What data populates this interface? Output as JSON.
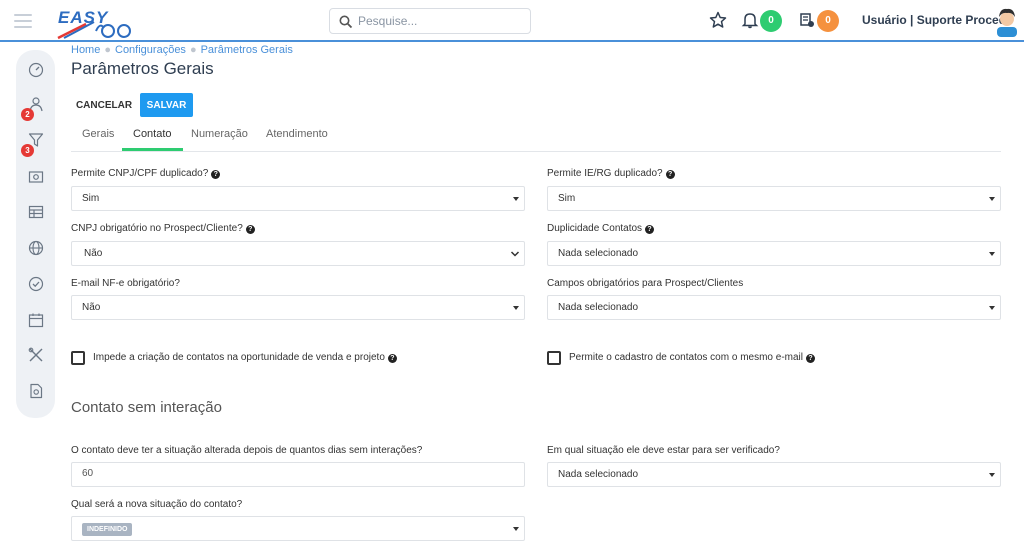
{
  "header": {
    "logo_text": "EASY",
    "search_placeholder": "Pesquise...",
    "notifications_count": "0",
    "tasks_count": "0",
    "user_label": "Usuário | Suporte Procedo",
    "colors": {
      "accent": "#4a90d9",
      "green_badge": "#2ecc71",
      "orange_badge": "#f5913e"
    }
  },
  "sidebar": {
    "items": [
      {
        "icon": "dashboard-icon"
      },
      {
        "icon": "user-icon",
        "badge": "2"
      },
      {
        "icon": "funnel-icon",
        "badge": "3"
      },
      {
        "icon": "money-icon"
      },
      {
        "icon": "table-icon"
      },
      {
        "icon": "globe-icon"
      },
      {
        "icon": "check-circle-icon"
      },
      {
        "icon": "calendar-icon"
      },
      {
        "icon": "tools-icon"
      },
      {
        "icon": "document-icon"
      }
    ]
  },
  "breadcrumb": {
    "home": "Home",
    "config": "Configurações",
    "current": "Parâmetros Gerais"
  },
  "page": {
    "title": "Parâmetros Gerais"
  },
  "toolbar": {
    "cancel_label": "CANCELAR",
    "save_label": "SALVAR"
  },
  "tabs": [
    {
      "label": "Gerais",
      "active": false
    },
    {
      "label": "Contato",
      "active": true
    },
    {
      "label": "Numeração",
      "active": false
    },
    {
      "label": "Atendimento",
      "active": false
    }
  ],
  "form": {
    "cnpj_dup": {
      "label": "Permite CNPJ/CPF duplicado?",
      "value": "Sim"
    },
    "ie_dup": {
      "label": "Permite IE/RG duplicado?",
      "value": "Sim"
    },
    "cnpj_obrig": {
      "label": "CNPJ obrigatório no Prospect/Cliente?",
      "value": "Não"
    },
    "dup_contatos": {
      "label": "Duplicidade Contatos",
      "value": "Nada selecionado"
    },
    "email_nfe": {
      "label": "E-mail NF-e obrigatório?",
      "value": "Não"
    },
    "campos_obrig": {
      "label": "Campos obrigatórios para Prospect/Clientes",
      "value": "Nada selecionado"
    },
    "impede_criacao": {
      "label": "Impede a criação de contatos na oportunidade de venda e projeto",
      "checked": false
    },
    "permite_cadastro": {
      "label": "Permite o cadastro de contatos com o mesmo e-mail",
      "checked": false
    }
  },
  "section": {
    "title": "Contato sem interação",
    "dias": {
      "label": "O contato deve ter a situação alterada depois de quantos dias sem interações?",
      "value": "60"
    },
    "situacao_verif": {
      "label": "Em qual situação ele deve estar para ser verificado?",
      "value": "Nada selecionado"
    },
    "nova_situacao": {
      "label": "Qual será a nova situação do contato?",
      "value": "INDEFINIDO"
    }
  }
}
